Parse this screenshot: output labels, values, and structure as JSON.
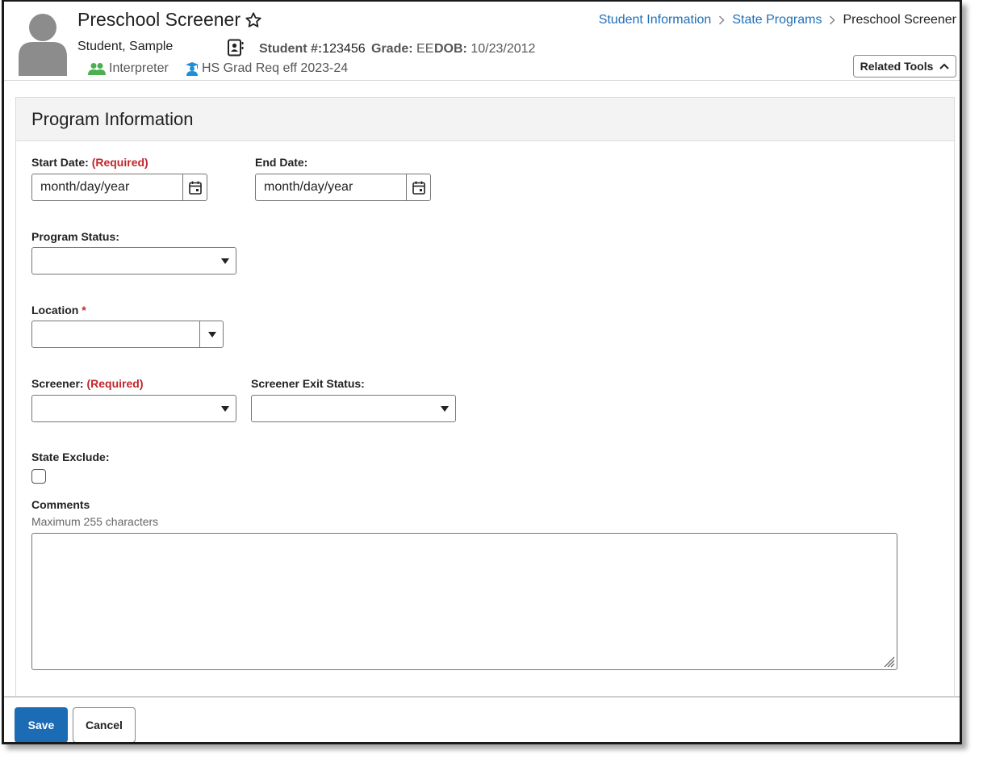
{
  "header": {
    "title": "Preschool Screener",
    "student_name": "Student, Sample",
    "student_number_label": "Student #:",
    "student_number": "123456",
    "grade_label": "Grade:",
    "grade": "EE",
    "dob_label": "DOB:",
    "dob": "10/23/2012",
    "flags": [
      {
        "label": "Interpreter",
        "icon": "people-icon",
        "color": "#4caf50"
      },
      {
        "label": "HS Grad Req eff 2023-24",
        "icon": "graduation-icon",
        "color": "#1e90d6"
      }
    ],
    "breadcrumb": [
      "Student Information",
      "State Programs",
      "Preschool Screener"
    ],
    "related_tools_label": "Related Tools"
  },
  "panel": {
    "title": "Program Information",
    "start_date": {
      "label": "Start Date:",
      "required_text": "(Required)",
      "value": "month/day/year"
    },
    "end_date": {
      "label": "End Date:",
      "value": "month/day/year"
    },
    "program_status": {
      "label": "Program Status:",
      "value": ""
    },
    "location": {
      "label": "Location",
      "required_mark": "*",
      "value": ""
    },
    "screener": {
      "label": "Screener:",
      "required_text": "(Required)",
      "value": ""
    },
    "screener_exit_status": {
      "label": "Screener Exit Status:",
      "value": ""
    },
    "state_exclude": {
      "label": "State Exclude:",
      "checked": false
    },
    "comments": {
      "label": "Comments",
      "hint": "Maximum 255 characters",
      "value": ""
    }
  },
  "footer": {
    "save_label": "Save",
    "cancel_label": "Cancel"
  },
  "colors": {
    "link": "#1e6fb8",
    "primary": "#1b6cb5",
    "required": "#c0262d"
  }
}
